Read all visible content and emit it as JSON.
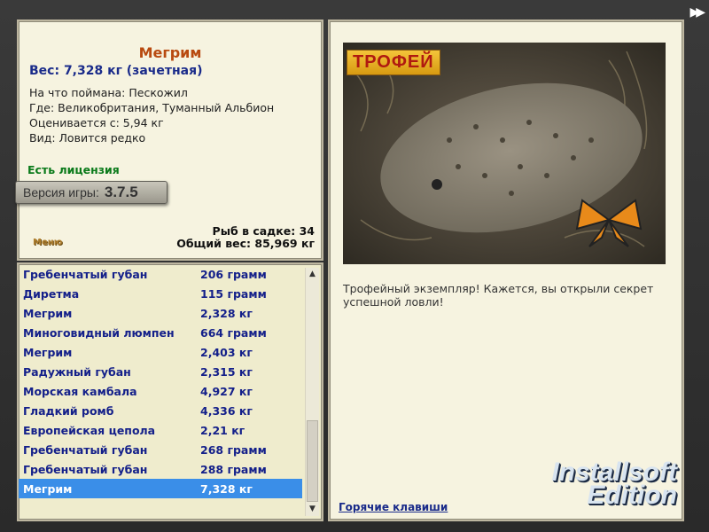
{
  "fish": {
    "title": "Мегрим",
    "weight": "Вес: 7,328 кг (зачетная)",
    "lines": [
      "На что поймана: Пескожил",
      "Где: Великобритания, Туманный Альбион",
      "Оценивается с: 5,94 кг",
      "Вид: Ловится редко"
    ],
    "license": "Есть лицензия",
    "version_label": "Версия игры:",
    "version_value": "3.7.5",
    "menu_link": "Меню",
    "stats_count": "Рыб в садке: 34",
    "stats_weight": "Общий вес: 85,969 кг"
  },
  "catch_list": [
    {
      "name": "Гребенчатый губан",
      "weight": "206 грамм"
    },
    {
      "name": "Диретма",
      "weight": "115 грамм"
    },
    {
      "name": "Мегрим",
      "weight": "2,328 кг"
    },
    {
      "name": "Миноговидный люмпен",
      "weight": "664 грамм"
    },
    {
      "name": "Мегрим",
      "weight": "2,403 кг"
    },
    {
      "name": "Радужный губан",
      "weight": "2,315 кг"
    },
    {
      "name": "Морская камбала",
      "weight": "4,927 кг"
    },
    {
      "name": "Гладкий ромб",
      "weight": "4,336 кг"
    },
    {
      "name": "Европейская цепола",
      "weight": "2,21 кг"
    },
    {
      "name": "Гребенчатый губан",
      "weight": "268 грамм"
    },
    {
      "name": "Гребенчатый губан",
      "weight": "288 грамм"
    },
    {
      "name": "Мегрим",
      "weight": "7,328 кг"
    }
  ],
  "selected_index": 11,
  "right": {
    "badge": "ТРОФЕЙ",
    "message": "Трофейный экземпляр! Кажется, вы открыли секрет успешной ловли!",
    "hotkeys": "Горячие клавиши",
    "brand_line1": "Installsoft",
    "brand_line2": "Edition"
  },
  "icons": {
    "scroll_up": "chevron-up-icon",
    "scroll_down": "chevron-down-icon",
    "next": "fast-forward-icon"
  }
}
